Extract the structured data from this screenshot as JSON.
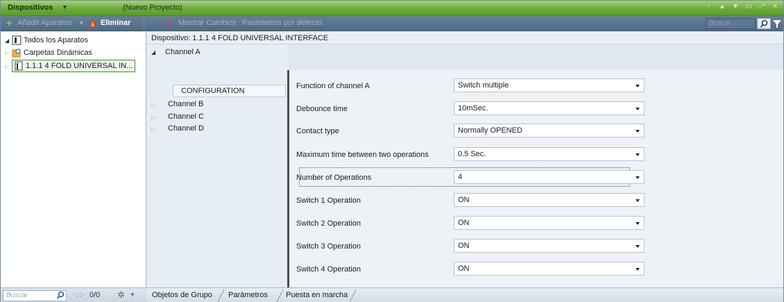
{
  "titlebar": {
    "title": "Dispositivos",
    "project": "(Nuevo Proyecto)"
  },
  "toolbar": {
    "add_label": "Añadir Aparatos",
    "delete_label": "Eliminar",
    "changes_label": "Mostrar Cambios",
    "defaults_label": "Parámetros por defecto",
    "search_placeholder": "Buscar"
  },
  "tree": {
    "items": [
      {
        "label": "Todos los Aparatos"
      },
      {
        "label": "Carpetas Dinámicas"
      },
      {
        "label": "1.1.1  4 FOLD UNIVERSAL IN..."
      }
    ]
  },
  "left_bottom": {
    "search_placeholder": "Buscar",
    "count": "0/0"
  },
  "device": {
    "label": "Dispositivo: 1.1.1  4 FOLD UNIVERSAL INTERFACE"
  },
  "channels": {
    "items": [
      {
        "label": "Channel A"
      },
      {
        "label": "CONFIGURATION"
      },
      {
        "label": "Channel B"
      },
      {
        "label": "Channel C"
      },
      {
        "label": "Channel D"
      }
    ]
  },
  "params": [
    {
      "label": "Function of channel A",
      "value": "Switch multiple"
    },
    {
      "label": "Debounce time",
      "value": "10mSec."
    },
    {
      "label": "Contact type",
      "value": "Normally OPENED"
    },
    {
      "label": "Maximum time between two operations",
      "value": "0.5 Sec."
    },
    {
      "label": "Number of Operations",
      "value": "4"
    },
    {
      "label": "Switch 1 Operation",
      "value": "ON"
    },
    {
      "label": "Switch 2 Operation",
      "value": "ON"
    },
    {
      "label": "Switch 3 Operation",
      "value": "ON"
    },
    {
      "label": "Switch 4 Operation",
      "value": "ON"
    }
  ],
  "tabs": [
    {
      "label": "Objetos de Grupo"
    },
    {
      "label": "Parámetros"
    },
    {
      "label": "Puesta en marcha"
    }
  ],
  "colors": {
    "titlebar_green": "#6aab3b",
    "toolbar_blue": "#526b85",
    "selection_border": "#3b8f2b"
  }
}
